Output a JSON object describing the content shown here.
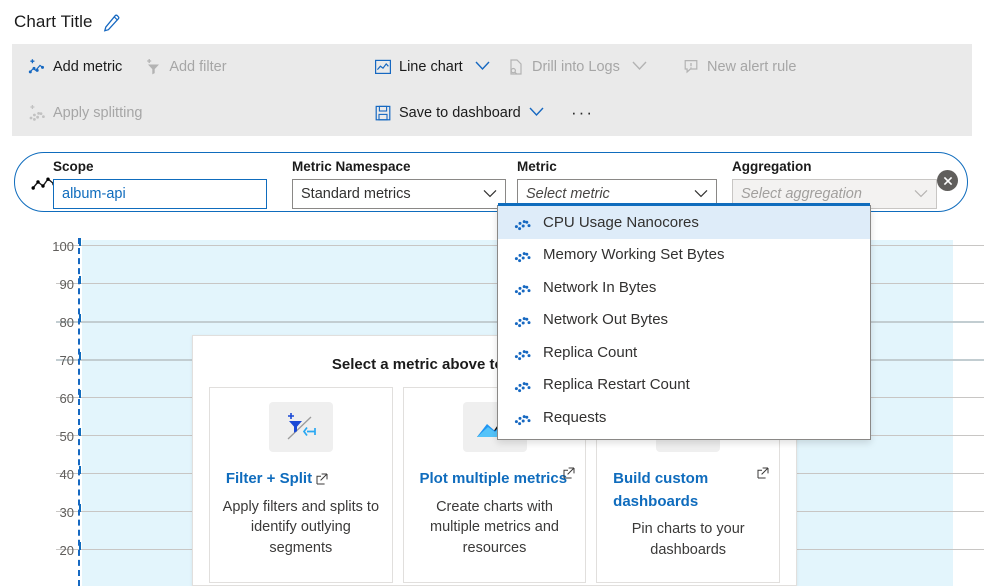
{
  "chart_title": {
    "text": "Chart Title",
    "edit_icon": "pencil-icon"
  },
  "command_bar": {
    "add_metric": {
      "label": "Add metric",
      "icon": "add-metric-icon",
      "disabled": false
    },
    "add_filter": {
      "label": "Add filter",
      "icon": "add-filter-icon",
      "disabled": true
    },
    "apply_splitting": {
      "label": "Apply splitting",
      "icon": "apply-splitting-icon",
      "disabled": true
    },
    "chart_type": {
      "label": "Line chart",
      "icon": "line-chart-icon",
      "chevron": "chevron-down-icon",
      "disabled": false
    },
    "drill_into_logs": {
      "label": "Drill into Logs",
      "icon": "drill-logs-icon",
      "chevron": "chevron-down-icon",
      "disabled": true
    },
    "new_alert_rule": {
      "label": "New alert rule",
      "icon": "alert-bell-icon",
      "disabled": true
    },
    "save_to_dashboard": {
      "label": "Save to dashboard",
      "icon": "save-icon",
      "chevron": "chevron-down-icon",
      "disabled": false
    },
    "more": {
      "label": "···",
      "icon": "ellipsis-icon"
    }
  },
  "selector": {
    "resource_icon": "metric-sparkline-icon",
    "scope": {
      "label": "Scope",
      "value": "album-api"
    },
    "namespace": {
      "label": "Metric Namespace",
      "value": "Standard metrics",
      "chevron": "chevron-down-icon"
    },
    "metric": {
      "label": "Metric",
      "value": "Select metric",
      "is_placeholder": true,
      "chevron": "chevron-down-icon"
    },
    "aggregation": {
      "label": "Aggregation",
      "value": "Select aggregation",
      "is_placeholder": true,
      "disabled": true,
      "chevron": "chevron-down-icon"
    },
    "close": {
      "label": "close",
      "icon": "close-circle-icon"
    }
  },
  "metric_dropdown": {
    "open": true,
    "selected_index": 0,
    "item_icon": "metric-scatter-icon",
    "items": [
      "CPU Usage Nanocores",
      "Memory Working Set Bytes",
      "Network In Bytes",
      "Network Out Bytes",
      "Replica Count",
      "Replica Restart Count",
      "Requests"
    ]
  },
  "empty_state": {
    "title": "Select a metric above to see data appear here",
    "cards": [
      {
        "icon": "filter-split-icon",
        "link": "Filter + Split",
        "external_icon": "external-link-icon",
        "description": "Apply filters and splits to identify outlying segments"
      },
      {
        "icon": "multi-metric-chart-icon",
        "link": "Plot multiple metrics",
        "external_icon": "external-link-icon",
        "description": "Create charts with multiple metrics and resources"
      },
      {
        "icon": "dashboard-pin-icon",
        "link": "Build custom dashboards",
        "external_icon": "external-link-icon",
        "description": "Pin charts to your dashboards"
      }
    ]
  },
  "chart_data": {
    "type": "line",
    "title": "Chart Title",
    "xlabel": "",
    "ylabel": "",
    "series": [],
    "categories": [],
    "values": [],
    "y_ticks": [
      100,
      90,
      80,
      70,
      60,
      50,
      40,
      30,
      20
    ],
    "ylim": [
      20,
      100
    ],
    "grid": true,
    "legend": "none",
    "empty": true,
    "annotations": [
      "Select a metric above to see data appear here"
    ],
    "highlight_band": {
      "color": "#e3f5fc",
      "note": "selected time range shading"
    },
    "marker_line": {
      "style": "dashed",
      "color": "#1668c1"
    }
  },
  "colors": {
    "accent": "#0f6cbd",
    "command_bar_bg": "#eaeaea",
    "band": "#e3f5fc",
    "dropdown_selected": "#deecf9",
    "disabled_text": "#a6a6a6"
  }
}
